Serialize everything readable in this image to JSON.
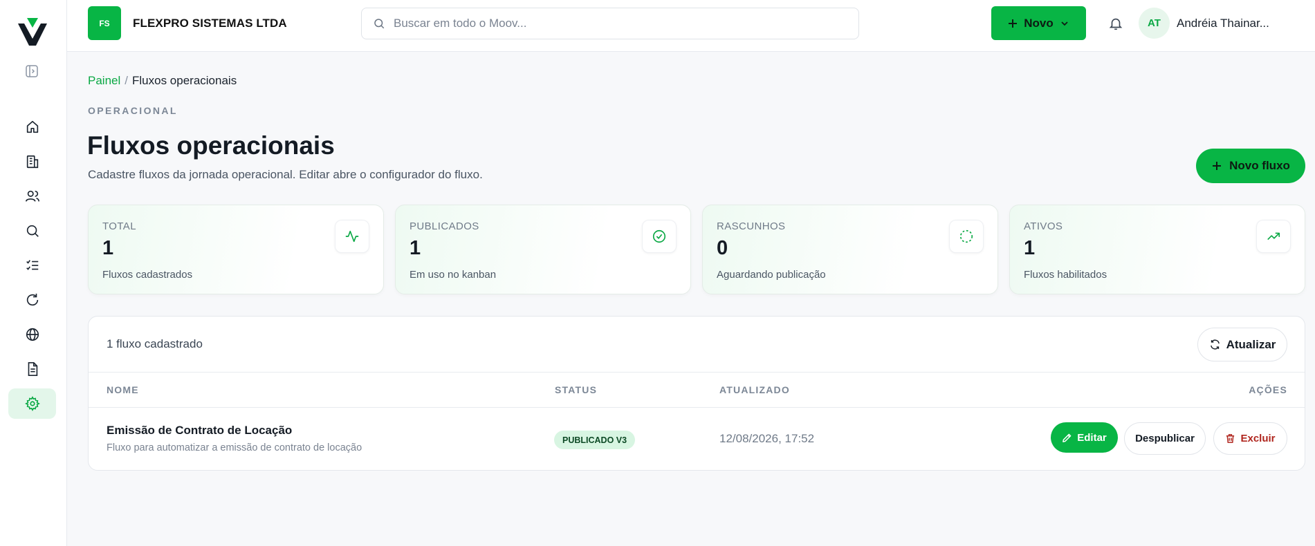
{
  "colors": {
    "accent": "#08b545",
    "accent_text": "#0aa844",
    "danger": "#b0261e"
  },
  "sidebar": {
    "logo": "moov-logo",
    "collapse_icon": "sidebar-toggle-icon",
    "items": [
      {
        "icon": "home-icon",
        "active": false
      },
      {
        "icon": "building-icon",
        "active": false
      },
      {
        "icon": "users-icon",
        "active": false
      },
      {
        "icon": "search-icon",
        "active": false
      },
      {
        "icon": "checklist-icon",
        "active": false
      },
      {
        "icon": "refresh-icon",
        "active": false
      },
      {
        "icon": "globe-icon",
        "active": false
      },
      {
        "icon": "document-icon",
        "active": false
      },
      {
        "icon": "gear-icon",
        "active": true
      }
    ]
  },
  "header": {
    "company_initials": "FS",
    "company_name": "FLEXPRO SISTEMAS LTDA",
    "search_placeholder": "Buscar em todo o Moov...",
    "new_button": "Novo",
    "user_initials": "AT",
    "user_name": "Andréia Thainar..."
  },
  "breadcrumb": {
    "home": "Painel",
    "separator": "/",
    "current": "Fluxos operacionais"
  },
  "page": {
    "section": "OPERACIONAL",
    "title": "Fluxos operacionais",
    "subtitle": "Cadastre fluxos da jornada operacional. Editar abre o configurador do fluxo.",
    "new_flow_button": "Novo fluxo"
  },
  "stats": [
    {
      "label": "TOTAL",
      "value": "1",
      "desc": "Fluxos cadastrados",
      "icon": "activity-icon"
    },
    {
      "label": "PUBLICADOS",
      "value": "1",
      "desc": "Em uso no kanban",
      "icon": "check-circle-icon"
    },
    {
      "label": "RASCUNHOS",
      "value": "0",
      "desc": "Aguardando publicação",
      "icon": "dashed-circle-icon"
    },
    {
      "label": "ATIVOS",
      "value": "1",
      "desc": "Fluxos habilitados",
      "icon": "trending-up-icon"
    }
  ],
  "table": {
    "count_text": "1 fluxo cadastrado",
    "refresh_button": "Atualizar",
    "columns": {
      "name": "NOME",
      "status": "STATUS",
      "updated": "ATUALIZADO",
      "actions": "AÇÕES"
    },
    "rows": [
      {
        "name": "Emissão de Contrato de Locação",
        "description": "Fluxo para automatizar a emissão de contrato de locação",
        "status": "PUBLICADO V3",
        "updated": "12/08/2026, 17:52",
        "edit": "Editar",
        "unpublish": "Despublicar",
        "delete": "Excluir"
      }
    ]
  }
}
